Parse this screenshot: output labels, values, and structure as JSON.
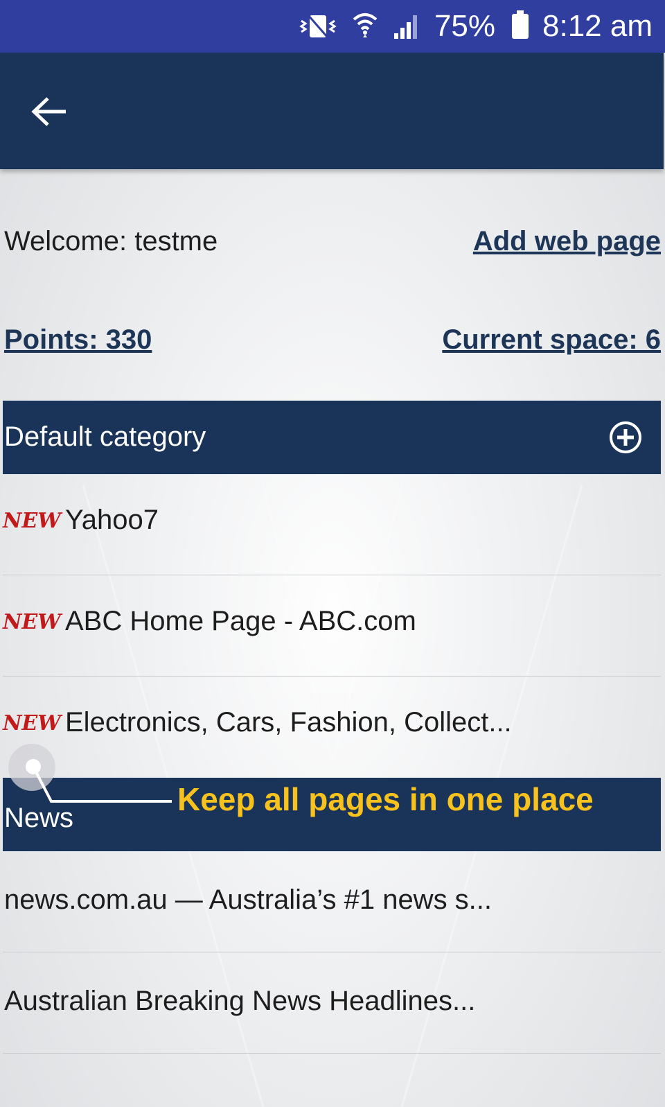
{
  "status_bar": {
    "battery": "75%",
    "time": "8:12 am",
    "icons": [
      "vibrate-icon",
      "wifi-icon",
      "signal-icon",
      "battery-icon"
    ]
  },
  "app_bar": {
    "back_icon": "arrow-left-icon"
  },
  "account": {
    "welcome": "Welcome: testme",
    "add_web_page": "Add web page",
    "points": "Points: 330",
    "current_space": "Current space: 6"
  },
  "categories": [
    {
      "name": "Default category",
      "items": [
        {
          "badge": "NEW",
          "title": "Yahoo7"
        },
        {
          "badge": "NEW",
          "title": "ABC Home Page - ABC.com"
        },
        {
          "badge": "NEW",
          "title": "Electronics, Cars, Fashion, Collect..."
        }
      ]
    },
    {
      "name": "News",
      "items": [
        {
          "title": "news.com.au — Australia’s #1 news s..."
        },
        {
          "title": "Australian Breaking News Headlines..."
        }
      ]
    }
  ],
  "tooltip": {
    "text": "Keep all pages in one place"
  },
  "colors": {
    "status_bar": "#303f9f",
    "app_bar": "#1a3358",
    "link": "#1d3557",
    "new_badge": "#c21a1a",
    "tooltip_text": "#f7c21e"
  }
}
